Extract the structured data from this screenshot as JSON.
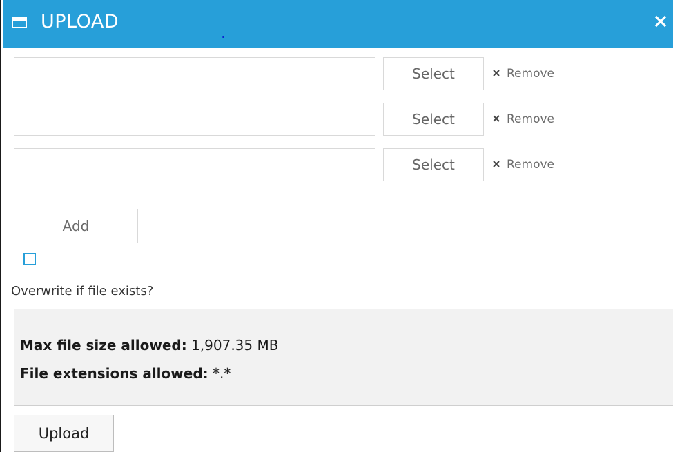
{
  "window": {
    "title": "UPLOAD",
    "accent_color": "#279fd9"
  },
  "file_rows": [
    {
      "value": "",
      "select_label": "Select",
      "remove_label": "Remove"
    },
    {
      "value": "",
      "select_label": "Select",
      "remove_label": "Remove"
    },
    {
      "value": "",
      "select_label": "Select",
      "remove_label": "Remove"
    }
  ],
  "add_label": "Add",
  "overwrite": {
    "checked": false,
    "label": "Overwrite if file exists?"
  },
  "info": {
    "max_size_label": "Max file size allowed:",
    "max_size_value": "1,907.35 MB",
    "extensions_label": "File extensions allowed:",
    "extensions_value": "*.*"
  },
  "upload_label": "Upload",
  "icons": {
    "title": "window-icon",
    "close": "close-icon",
    "remove": "close-icon"
  }
}
